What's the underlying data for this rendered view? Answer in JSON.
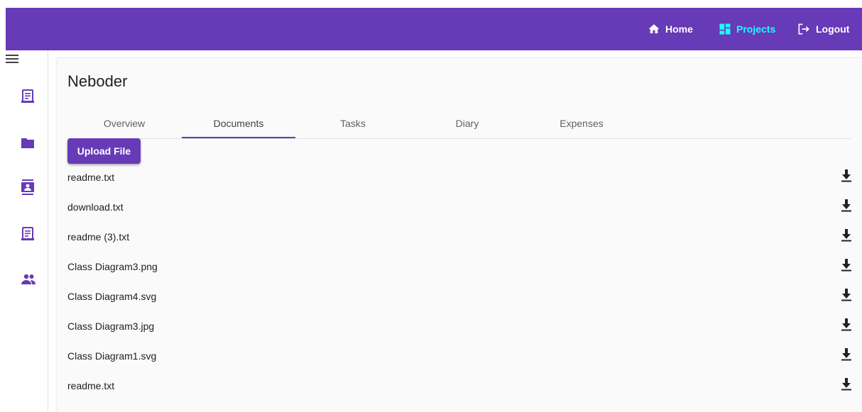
{
  "nav": {
    "home_label": "Home",
    "projects_label": "Projects",
    "logout_label": "Logout"
  },
  "sidebar": {
    "icons": [
      "menu-icon",
      "notes-icon",
      "folder-icon",
      "contact-card-icon",
      "notes-icon",
      "group-icon"
    ]
  },
  "project": {
    "title": "Neboder"
  },
  "tabs": [
    {
      "label": "Overview"
    },
    {
      "label": "Documents"
    },
    {
      "label": "Tasks"
    },
    {
      "label": "Diary"
    },
    {
      "label": "Expenses"
    }
  ],
  "active_tab": "Documents",
  "upload_label": "Upload File",
  "files": [
    {
      "name": "readme.txt"
    },
    {
      "name": "download.txt"
    },
    {
      "name": "readme (3).txt"
    },
    {
      "name": "Class Diagram3.png"
    },
    {
      "name": "Class Diagram4.svg"
    },
    {
      "name": "Class Diagram3.jpg"
    },
    {
      "name": "Class Diagram1.svg"
    },
    {
      "name": "readme.txt"
    }
  ],
  "colors": {
    "primary": "#673ab7",
    "active_nav": "#18ffff"
  }
}
